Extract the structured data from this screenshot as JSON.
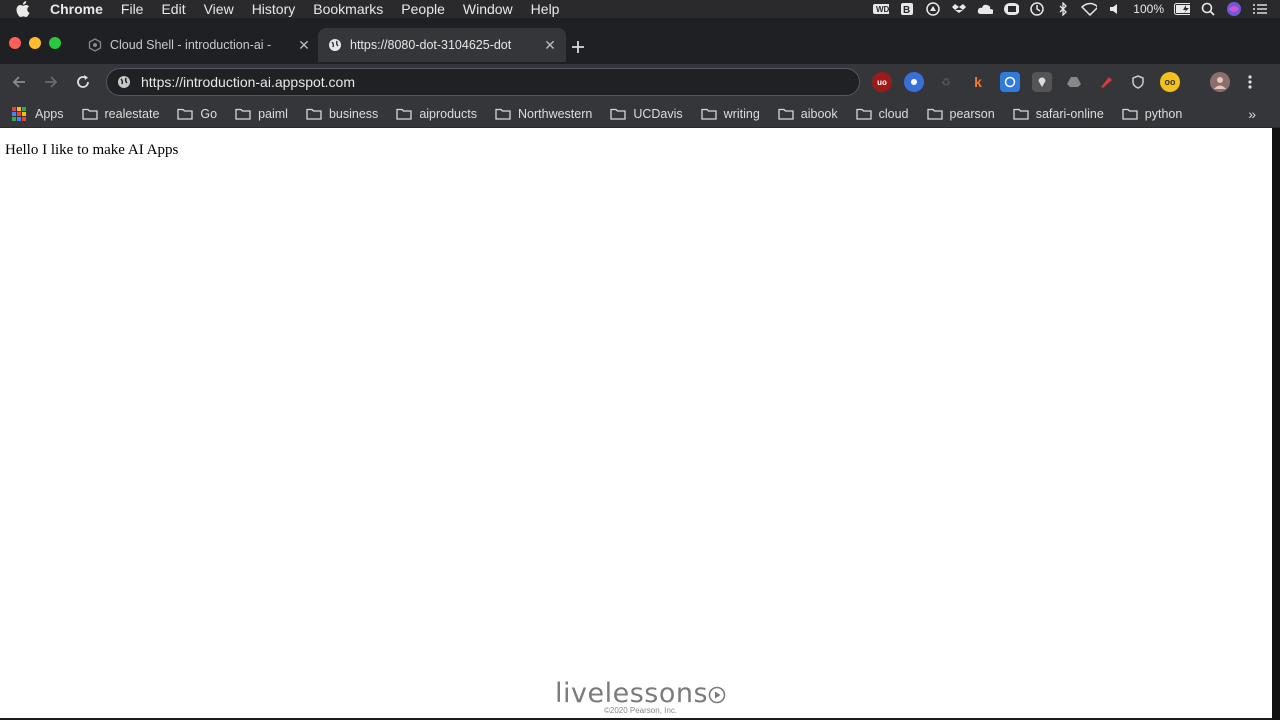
{
  "menubar": {
    "app_name": "Chrome",
    "items": [
      "File",
      "Edit",
      "View",
      "History",
      "Bookmarks",
      "People",
      "Window",
      "Help"
    ],
    "status": {
      "battery": "100%"
    },
    "icons": [
      "wd-icon",
      "b-icon",
      "drive-icon",
      "dropbox-icon",
      "cloud-icon",
      "display-icon",
      "time-machine-icon",
      "bluetooth-icon",
      "wifi-icon",
      "volume-icon",
      "battery-icon",
      "search-icon",
      "siri-icon",
      "notifications-icon"
    ]
  },
  "tabs": [
    {
      "title": "Cloud Shell - introduction-ai - ",
      "active": false,
      "icon": "cloud-shell-icon"
    },
    {
      "title": "https://8080-dot-3104625-dot",
      "active": true,
      "icon": "globe-icon"
    }
  ],
  "toolbar": {
    "url": "https://introduction-ai.appspot.com"
  },
  "bookmarks": {
    "apps_label": "Apps",
    "folders": [
      "realestate",
      "Go",
      "paiml",
      "business",
      "aiproducts",
      "Northwestern",
      "UCDavis",
      "writing",
      "aibook",
      "cloud",
      "pearson",
      "safari-online",
      "python"
    ]
  },
  "page": {
    "text": "Hello I like to make AI Apps"
  },
  "watermark": {
    "brand": "livelessons",
    "copyright": "©2020 Pearson, Inc."
  },
  "colors": {
    "tab_strip": "#1f2023",
    "toolbar": "#35363a",
    "page_bg": "#ffffff"
  }
}
